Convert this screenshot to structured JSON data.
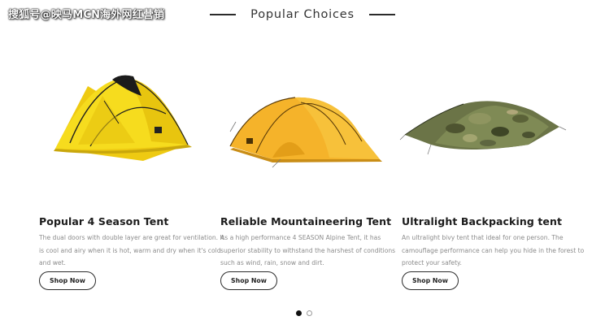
{
  "watermark": "搜狐号@映马MCN海外网红营销",
  "section": {
    "title": "Popular Choices"
  },
  "products": [
    {
      "title": "Popular 4 Season Tent",
      "description": "The dual doors with double layer are great for ventilation. It is cool and airy when it is hot, warm and dry when it's cold and wet.",
      "button_label": "Shop Now",
      "image_icon": "yellow-dome-tent",
      "color": "#f2d722"
    },
    {
      "title": "Reliable Mountaineering Tent",
      "description": "As a high performance 4 SEASON Alpine Tent, it has superior stability to withstand the harshest of conditions such as wind, rain, snow and dirt.",
      "button_label": "Shop Now",
      "image_icon": "orange-tunnel-tent",
      "color": "#f5b62a"
    },
    {
      "title": "Ultralight Backpacking tent",
      "description": "An ultralight bivy tent that ideal for one person. The camouflage performance can help you hide in the forest to protect your safety.",
      "button_label": "Shop Now",
      "image_icon": "camouflage-bivy-tent",
      "color": "#6f7a48"
    }
  ],
  "pagination": {
    "total": 2,
    "active": 1
  }
}
